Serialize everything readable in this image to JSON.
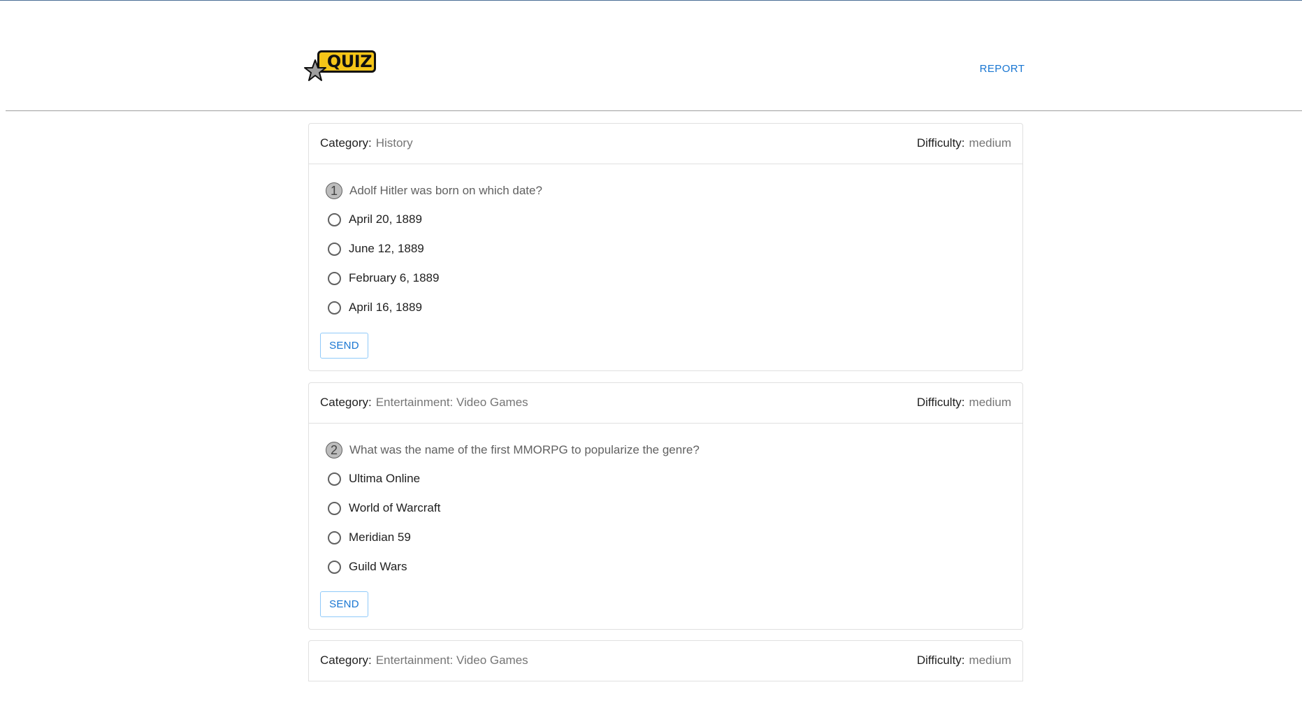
{
  "header": {
    "logo_text": "QUIZ",
    "report_label": "REPORT"
  },
  "labels": {
    "category": "Category:",
    "difficulty": "Difficulty:",
    "send": "SEND"
  },
  "questions": [
    {
      "number": "1",
      "category": "History",
      "difficulty": "medium",
      "text": "Adolf Hitler was born on which date?",
      "options": [
        "April 20, 1889",
        "June 12, 1889",
        "February 6, 1889",
        "April 16, 1889"
      ]
    },
    {
      "number": "2",
      "category": "Entertainment: Video Games",
      "difficulty": "medium",
      "text": "What was the name of the first MMORPG to popularize the genre?",
      "options": [
        "Ultima Online",
        "World of Warcraft",
        "Meridian 59",
        "Guild Wars"
      ]
    },
    {
      "category": "Entertainment: Video Games",
      "difficulty": "medium"
    }
  ],
  "colors": {
    "accent": "#1976d2",
    "logo_yellow": "#f5c518"
  }
}
